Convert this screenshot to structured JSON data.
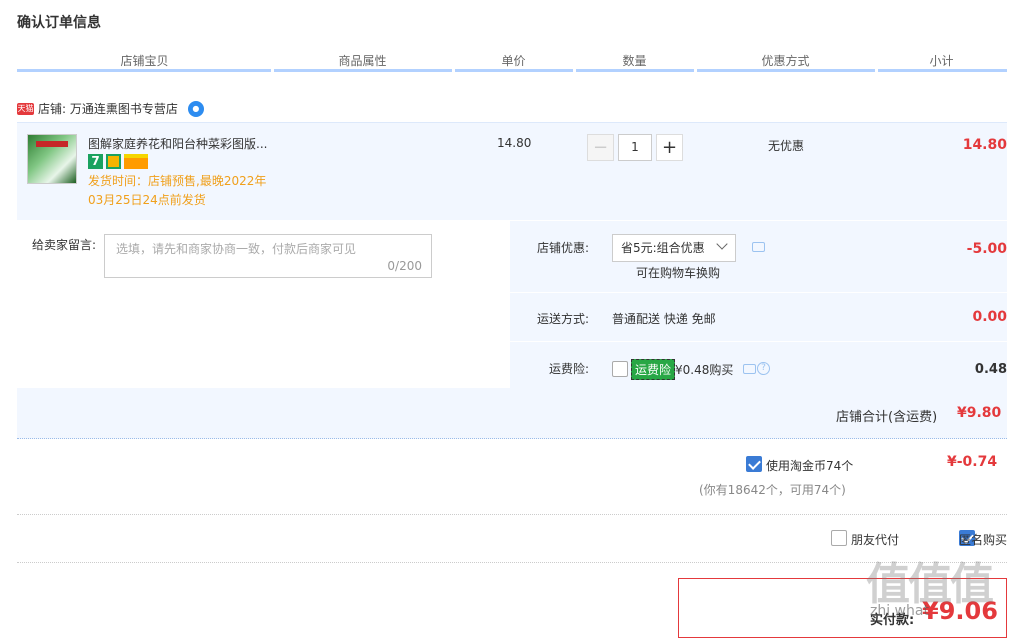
{
  "title": "确认订单信息",
  "headers": [
    "店铺宝贝",
    "商品属性",
    "单价",
    "数量",
    "优惠方式",
    "小计"
  ],
  "shop": {
    "label": "店铺: 万通连熏图书专营店",
    "tmall": "天猫"
  },
  "item": {
    "name": "图解家庭养花和阳台种菜彩图版...",
    "badge7": "7",
    "ship_line1": "发货时间：店铺预售,最晚2022年",
    "ship_line2": "03月25日24点前发货",
    "price": "14.80",
    "qty": "1",
    "minus": "−",
    "plus": "+",
    "discount": "无优惠",
    "subtotal": "14.80"
  },
  "message": {
    "label": "给卖家留言:",
    "placeholder": "选填，请先和商家协商一致，付款后商家可见",
    "count": "0/200"
  },
  "store_discount": {
    "label": "店铺优惠:",
    "selected": "省5元:组合优惠",
    "hint": "可在购物车换购",
    "amount": "-5.00"
  },
  "shipping": {
    "label": "运送方式:",
    "value": "普通配送 快递 免邮",
    "amount": "0.00"
  },
  "insurance": {
    "label": "运费险:",
    "badge": "运费险",
    "price": "¥0.48购买",
    "amount": "0.48"
  },
  "store_total": {
    "label": "店铺合计(含运费)",
    "amount": "¥9.80"
  },
  "coins": {
    "label": "使用淘金币74个",
    "note": "(你有18642个，可用74个)",
    "amount": "¥-0.74"
  },
  "options": {
    "friend_pay": "朋友代付",
    "anonymous": "匿名购买"
  },
  "pay": {
    "label": "实付款:",
    "amount": "¥9.06"
  },
  "watermark": {
    "big": "值值值",
    "small": "zhi what"
  },
  "colors": {
    "accent": "#e4393c",
    "header_line": "#b2d1ff",
    "panel": "#f2f7ff"
  }
}
